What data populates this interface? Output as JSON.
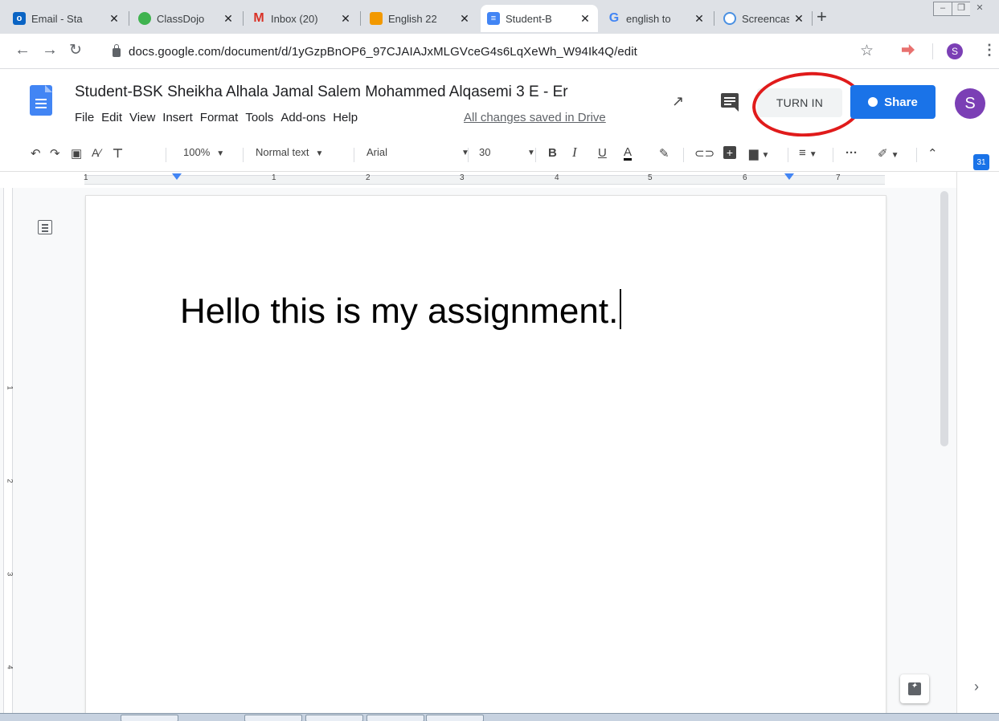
{
  "browser": {
    "tabs": [
      {
        "title": "Email - Sta",
        "icon": "outlook-icon",
        "color": "#0a64c4"
      },
      {
        "title": "ClassDojo",
        "icon": "classdojo-icon",
        "color": "#3fb34f"
      },
      {
        "title": "Inbox (20)",
        "icon": "gmail-icon",
        "color": "#d93025"
      },
      {
        "title": "English 22",
        "icon": "classroom-icon",
        "color": "#f29900"
      },
      {
        "title": "Student-B",
        "icon": "docs-icon",
        "color": "#4285f4"
      },
      {
        "title": "english to",
        "icon": "google-icon",
        "color": "#4285f4"
      },
      {
        "title": "Screencas",
        "icon": "screencastify-icon",
        "color": "#4a90e2"
      }
    ],
    "url": "docs.google.com/document/d/1yGzpBnOP6_97CJAIAJxMLGVceG4s6LqXeWh_W94Ik4Q/edit",
    "profile_initial": "S"
  },
  "doc": {
    "title": "Student-BSK Sheikha Alhala Jamal Salem Mohammed Alqasemi 3 E - Er",
    "menu": [
      "File",
      "Edit",
      "View",
      "Insert",
      "Format",
      "Tools",
      "Add-ons",
      "Help"
    ],
    "save_status": "All changes saved in Drive",
    "turn_in_label": "TURN IN",
    "share_label": "Share",
    "user_initial": "S",
    "body_text": "Hello this is my assignment."
  },
  "format_toolbar": {
    "zoom": "100%",
    "style": "Normal text",
    "font": "Arial",
    "size": "30",
    "calendar_day": "31"
  },
  "ruler": {
    "h_numbers": [
      "1",
      "1",
      "2",
      "3",
      "4",
      "5",
      "6",
      "7"
    ],
    "v_numbers": [
      "1",
      "2",
      "3",
      "4"
    ]
  },
  "colors": {
    "accent": "#1a73e8",
    "annotation": "#e01b1b"
  }
}
